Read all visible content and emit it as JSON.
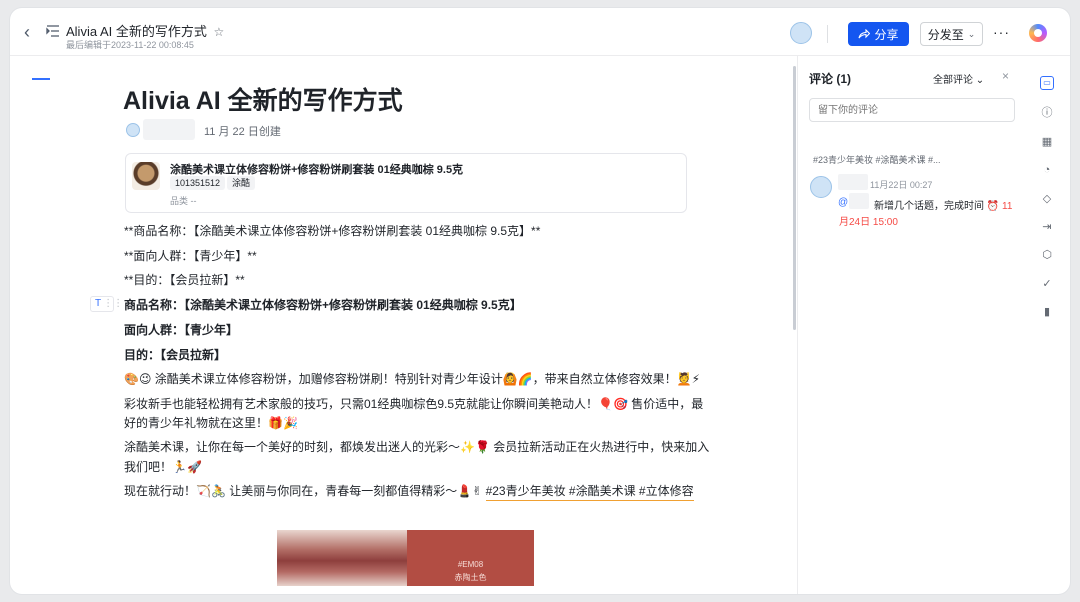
{
  "header": {
    "back_icon": "chevron-left-icon",
    "title": "Alivia AI 全新的写作方式",
    "star_icon": "☆",
    "meta": "最后编辑于2023-11-22 00:08:45",
    "share_label": "分享",
    "send_label": "分发至",
    "more_label": "···",
    "accent": "#1456f0"
  },
  "doc": {
    "title": "Alivia AI 全新的写作方式",
    "created": "11 月 22 日创建",
    "card": {
      "title": "涂酷美术课立体修容粉饼+修容粉饼刷套装 01经典咖棕 9.5克",
      "tag1": "101351512",
      "tag2": "涂酷",
      "category": "品类  --"
    },
    "lines": [
      "**商品名称：【涂酷美术课立体修容粉饼+修容粉饼刷套装 01经典咖棕 9.5克】**",
      "**面向人群：【青少年】**",
      "**目的：【会员拉新】**",
      "商品名称：【涂酷美术课立体修容粉饼+修容粉饼刷套装 01经典咖棕 9.5克】",
      "面向人群：【青少年】",
      "目的：【会员拉新】",
      "🎨😉 涂酷美术课立体修容粉饼，加赠修容粉饼刷！特别针对青少年设计🙆🌈，带来自然立体修容效果！💆⚡",
      "彩妆新手也能轻松拥有艺术家般的技巧，只需01经典咖棕色9.5克就能让你瞬间美艳动人！🎈🎯 售价适中，最",
      "好的青少年礼物就在这里！🎁🎉",
      "涂酷美术课，让你在每一个美好的时刻，都焕发出迷人的光彩～✨🌹 会员拉新活动正在火热进行中，快来加入",
      "我们吧！🏃🚀",
      "现在就行动！🏹🚴 让美丽与你同在，青春每一刻都值得精彩～💄✌"
    ],
    "hashtags": "#23青少年美妆 #涂酷美术课 #立体修容",
    "handle_label": "T",
    "handle_dots": "⋮⋮",
    "swatch_code": "#EM08",
    "swatch_name": "赤陶土色"
  },
  "comments": {
    "title": "评论 (1)",
    "filter": "全部评论 ⌄",
    "close": "×",
    "input_placeholder": "留下你的评论",
    "quote": "#23青少年美妆 #涂酷美术课 #...",
    "item": {
      "time": "11月22日 00:27",
      "at": "@",
      "text": "新增几个话题，完成时间",
      "clock": "⏰ 11",
      "due": "月24日 15:00"
    }
  },
  "rail": {
    "icons": [
      "comment-icon",
      "info-icon",
      "ai-icon",
      "history-icon",
      "tag-icon",
      "export-icon",
      "plugin-icon",
      "task-icon",
      "stats-icon"
    ],
    "glyphs": [
      "▭",
      "ⓘ",
      "▦",
      "◔",
      "◇",
      "⇥",
      "⬡",
      "✓",
      "▮"
    ]
  }
}
